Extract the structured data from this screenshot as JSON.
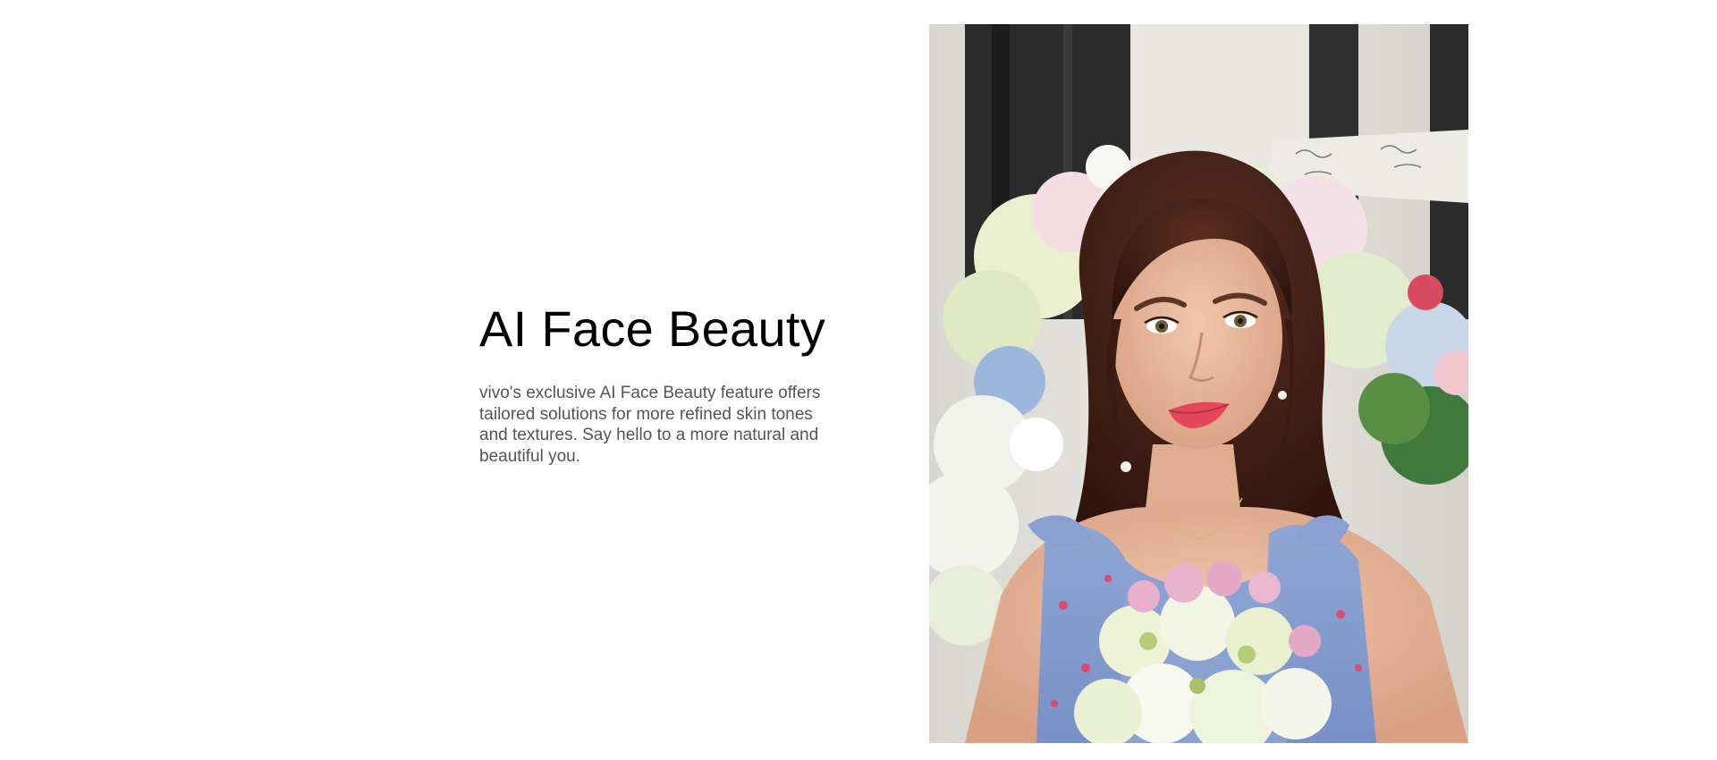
{
  "feature": {
    "title": "AI Face Beauty",
    "description": "vivo's exclusive AI Face Beauty feature offers tailored solutions for more refined skin tones and textures. Say hello to a more natural and beautiful you."
  },
  "photo": {
    "subject": "selfie-portrait-woman-with-flowers"
  }
}
